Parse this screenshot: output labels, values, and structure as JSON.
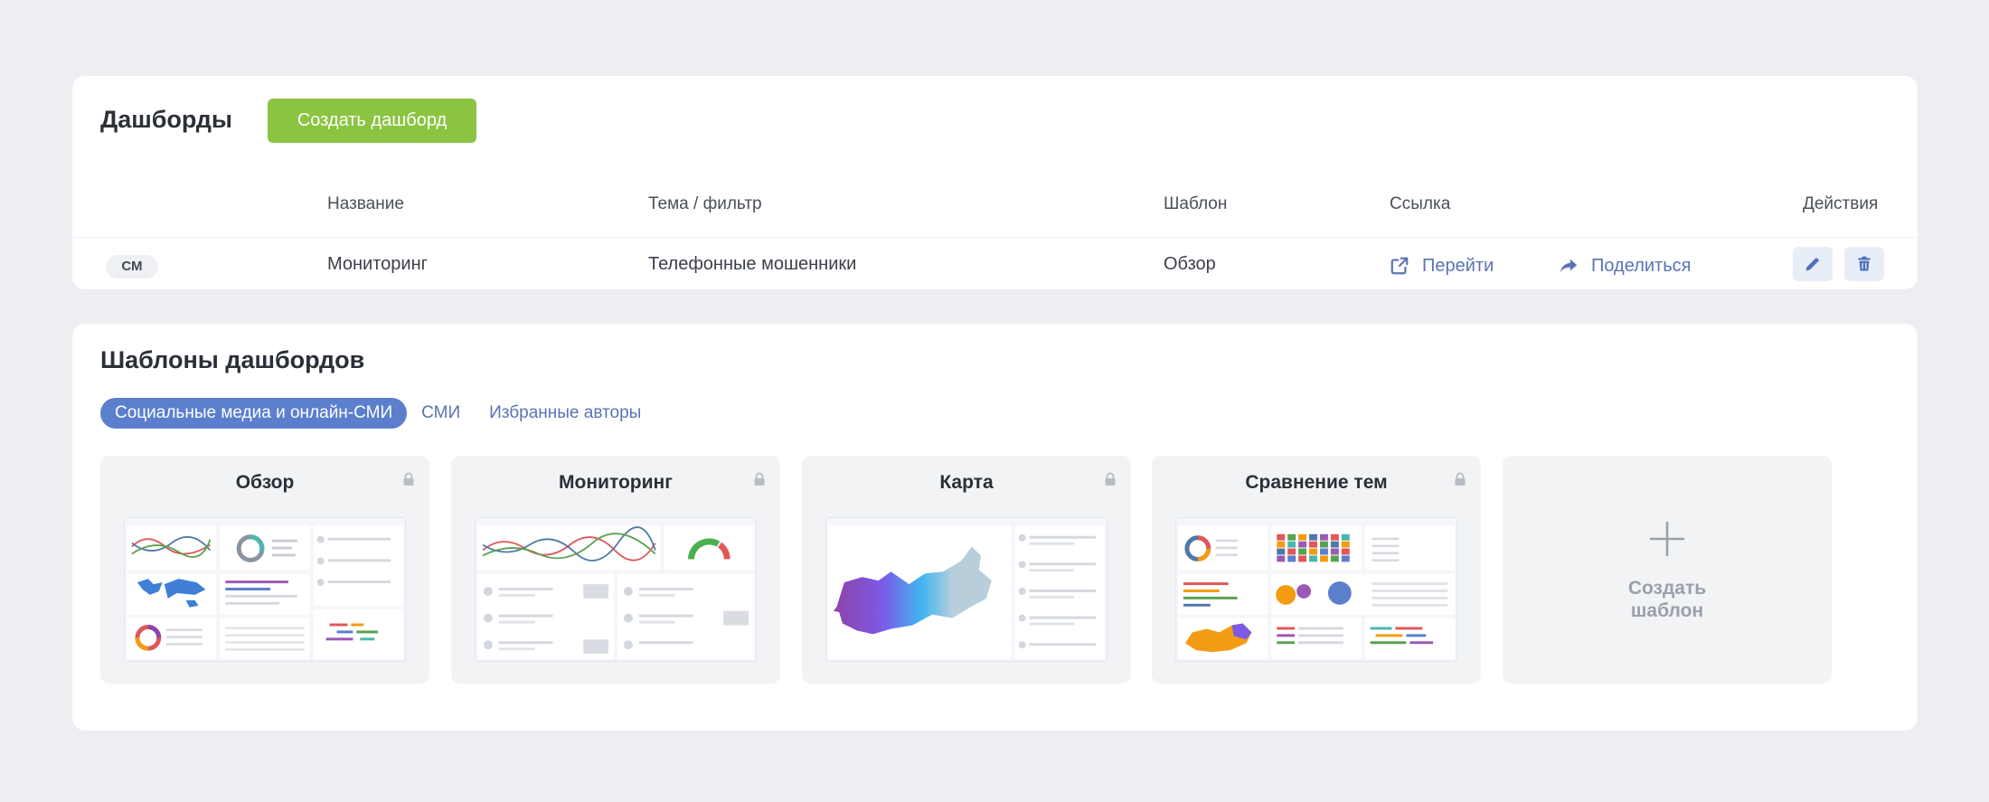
{
  "dashboards": {
    "title": "Дашборды",
    "create_button": "Создать дашборд",
    "columns": {
      "name": "Название",
      "topic": "Тема / фильтр",
      "template": "Шаблон",
      "link": "Ссылка",
      "actions": "Действия"
    },
    "rows": [
      {
        "badge": "СМ",
        "name": "Мониторинг",
        "topic": "Телефонные мошенники",
        "template": "Обзор",
        "go_label": "Перейти",
        "share_label": "Поделиться"
      }
    ]
  },
  "templates": {
    "title": "Шаблоны дашбордов",
    "tabs": [
      "Социальные медиа и онлайн-СМИ",
      "СМИ",
      "Избранные авторы"
    ],
    "active_tab": 0,
    "cards": [
      "Обзор",
      "Мониторинг",
      "Карта",
      "Сравнение тем"
    ],
    "create_label": "Создать\nшаблон"
  },
  "colors": {
    "accent_green": "#8bc441",
    "accent_blue": "#5b7fcd",
    "link_blue": "#5a73b3"
  },
  "icons": {
    "lock": "lock-icon",
    "go": "external-link-icon",
    "share": "share-arrow-icon",
    "edit": "pencil-icon",
    "delete": "trash-icon",
    "add": "plus-icon"
  }
}
